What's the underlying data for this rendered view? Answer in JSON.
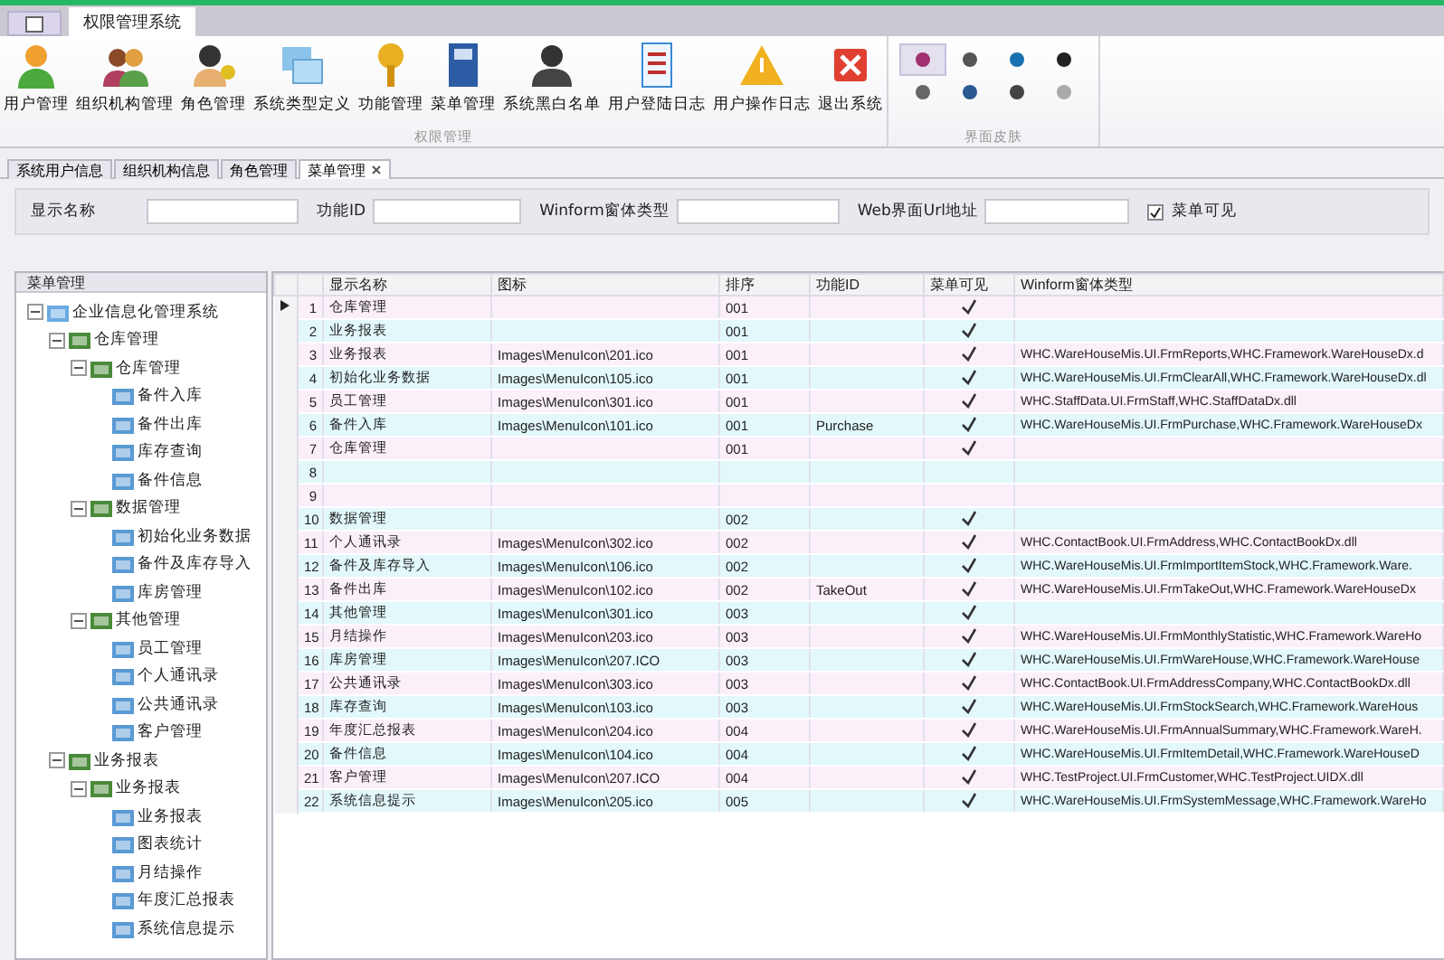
{
  "app_tab": "权限管理系统",
  "ribbon": {
    "groups": [
      {
        "label": "权限管理",
        "buttons": [
          {
            "label": "用户管理"
          },
          {
            "label": "组织机构管理"
          },
          {
            "label": "角色管理"
          },
          {
            "label": "系统类型定义"
          },
          {
            "label": "功能管理"
          },
          {
            "label": "菜单管理"
          },
          {
            "label": "系统黑白名单"
          },
          {
            "label": "用户登陆日志"
          },
          {
            "label": "用户操作日志"
          },
          {
            "label": "退出系统"
          }
        ]
      }
    ],
    "skins": {
      "label": "界面皮肤",
      "items": [
        {
          "selected": true
        },
        {
          "selected": false
        },
        {
          "selected": false
        },
        {
          "selected": false
        },
        {
          "selected": false
        },
        {
          "selected": false
        },
        {
          "selected": false
        },
        {
          "selected": false
        }
      ]
    }
  },
  "tabs": [
    {
      "label": "系统用户信息",
      "selected": false
    },
    {
      "label": "组织机构信息",
      "selected": false
    },
    {
      "label": "角色管理",
      "selected": false
    },
    {
      "label": "菜单管理",
      "selected": true
    }
  ],
  "filter": {
    "fields": [
      {
        "label": "显示名称"
      },
      {
        "label": "功能ID"
      },
      {
        "label": "Winform窗体类型"
      },
      {
        "label": "Web界面Url地址"
      }
    ],
    "visible": {
      "label": "菜单可见",
      "checked": true
    }
  },
  "tree": {
    "title": "菜单管理",
    "items": [
      {
        "label": "企业信息化管理系统",
        "expanded": true,
        "children": [
          {
            "label": "仓库管理",
            "expanded": true,
            "children": [
              {
                "label": "仓库管理",
                "expanded": true,
                "children": [
                  {
                    "label": "备件入库"
                  },
                  {
                    "label": "备件出库"
                  },
                  {
                    "label": "库存查询"
                  },
                  {
                    "label": "备件信息"
                  }
                ]
              },
              {
                "label": "数据管理",
                "expanded": true,
                "children": [
                  {
                    "label": "初始化业务数据"
                  },
                  {
                    "label": "备件及库存导入"
                  },
                  {
                    "label": "库房管理"
                  }
                ]
              },
              {
                "label": "其他管理",
                "expanded": true,
                "children": [
                  {
                    "label": "员工管理"
                  },
                  {
                    "label": "个人通讯录"
                  },
                  {
                    "label": "公共通讯录"
                  },
                  {
                    "label": "客户管理"
                  }
                ]
              }
            ]
          },
          {
            "label": "业务报表",
            "expanded": true,
            "children": [
              {
                "label": "业务报表",
                "expanded": true,
                "children": [
                  {
                    "label": "业务报表"
                  },
                  {
                    "label": "图表统计"
                  },
                  {
                    "label": "月结操作"
                  },
                  {
                    "label": "年度汇总报表"
                  },
                  {
                    "label": "系统信息提示"
                  }
                ]
              }
            ]
          }
        ]
      }
    ]
  },
  "table": {
    "columns": [
      "显示名称",
      "图标",
      "排序",
      "功能ID",
      "菜单可见",
      "Winform窗体类型"
    ],
    "rows": [
      {
        "no": "1",
        "selected": true,
        "name": "仓库管理",
        "icon": "",
        "sort": "001",
        "func": "",
        "visible": true,
        "winform": ""
      },
      {
        "no": "2",
        "selected": false,
        "name": "业务报表",
        "icon": "",
        "sort": "001",
        "func": "",
        "visible": true,
        "winform": ""
      },
      {
        "no": "3",
        "selected": false,
        "name": "业务报表",
        "icon": "Images\\MenuIcon\\201.ico",
        "sort": "001",
        "func": "",
        "visible": true,
        "winform": "WHC.WareHouseMis.UI.FrmReports,WHC.Framework.WareHouseDx.d"
      },
      {
        "no": "4",
        "selected": false,
        "name": "初始化业务数据",
        "icon": "Images\\MenuIcon\\105.ico",
        "sort": "001",
        "func": "",
        "visible": true,
        "winform": "WHC.WareHouseMis.UI.FrmClearAll,WHC.Framework.WareHouseDx.dl"
      },
      {
        "no": "5",
        "selected": false,
        "name": "员工管理",
        "icon": "Images\\MenuIcon\\301.ico",
        "sort": "001",
        "func": "",
        "visible": true,
        "winform": "WHC.StaffData.UI.FrmStaff,WHC.StaffDataDx.dll"
      },
      {
        "no": "6",
        "selected": false,
        "name": "备件入库",
        "icon": "Images\\MenuIcon\\101.ico",
        "sort": "001",
        "func": "Purchase",
        "visible": true,
        "winform": "WHC.WareHouseMis.UI.FrmPurchase,WHC.Framework.WareHouseDx"
      },
      {
        "no": "7",
        "selected": false,
        "name": "仓库管理",
        "icon": "",
        "sort": "001",
        "func": "",
        "visible": true,
        "winform": ""
      },
      {
        "no": "8",
        "selected": false,
        "name": "",
        "icon": "",
        "sort": "",
        "func": "",
        "winform": ""
      },
      {
        "no": "9",
        "selected": false,
        "name": "",
        "icon": "",
        "sort": "",
        "func": "",
        "winform": ""
      },
      {
        "no": "10",
        "selected": false,
        "name": "数据管理",
        "icon": "",
        "sort": "002",
        "func": "",
        "visible": true,
        "winform": ""
      },
      {
        "no": "11",
        "selected": false,
        "name": "个人通讯录",
        "icon": "Images\\MenuIcon\\302.ico",
        "sort": "002",
        "func": "",
        "visible": true,
        "winform": "WHC.ContactBook.UI.FrmAddress,WHC.ContactBookDx.dll"
      },
      {
        "no": "12",
        "selected": false,
        "name": "备件及库存导入",
        "icon": "Images\\MenuIcon\\106.ico",
        "sort": "002",
        "func": "",
        "visible": true,
        "winform": "WHC.WareHouseMis.UI.FrmImportItemStock,WHC.Framework.Ware."
      },
      {
        "no": "13",
        "selected": false,
        "name": "备件出库",
        "icon": "Images\\MenuIcon\\102.ico",
        "sort": "002",
        "func": "TakeOut",
        "visible": true,
        "winform": "WHC.WareHouseMis.UI.FrmTakeOut,WHC.Framework.WareHouseDx"
      },
      {
        "no": "14",
        "selected": false,
        "name": "其他管理",
        "icon": "Images\\MenuIcon\\301.ico",
        "sort": "003",
        "func": "",
        "visible": true,
        "winform": ""
      },
      {
        "no": "15",
        "selected": false,
        "name": "月结操作",
        "icon": "Images\\MenuIcon\\203.ico",
        "sort": "003",
        "func": "",
        "visible": true,
        "winform": "WHC.WareHouseMis.UI.FrmMonthlyStatistic,WHC.Framework.WareHo"
      },
      {
        "no": "16",
        "selected": false,
        "name": "库房管理",
        "icon": "Images\\MenuIcon\\207.ICO",
        "sort": "003",
        "func": "",
        "visible": true,
        "winform": "WHC.WareHouseMis.UI.FrmWareHouse,WHC.Framework.WareHouse"
      },
      {
        "no": "17",
        "selected": false,
        "name": "公共通讯录",
        "icon": "Images\\MenuIcon\\303.ico",
        "sort": "003",
        "func": "",
        "visible": true,
        "winform": "WHC.ContactBook.UI.FrmAddressCompany,WHC.ContactBookDx.dll"
      },
      {
        "no": "18",
        "selected": false,
        "name": "库存查询",
        "icon": "Images\\MenuIcon\\103.ico",
        "sort": "003",
        "func": "",
        "visible": true,
        "winform": "WHC.WareHouseMis.UI.FrmStockSearch,WHC.Framework.WareHous"
      },
      {
        "no": "19",
        "selected": false,
        "name": "年度汇总报表",
        "icon": "Images\\MenuIcon\\204.ico",
        "sort": "004",
        "func": "",
        "visible": true,
        "winform": "WHC.WareHouseMis.UI.FrmAnnualSummary,WHC.Framework.WareH."
      },
      {
        "no": "20",
        "selected": false,
        "name": "备件信息",
        "icon": "Images\\MenuIcon\\104.ico",
        "sort": "004",
        "func": "",
        "visible": true,
        "winform": "WHC.WareHouseMis.UI.FrmItemDetail,WHC.Framework.WareHouseD"
      },
      {
        "no": "21",
        "selected": false,
        "name": "客户管理",
        "icon": "Images\\MenuIcon\\207.ICO",
        "sort": "004",
        "func": "",
        "visible": true,
        "winform": "WHC.TestProject.UI.FrmCustomer,WHC.TestProject.UIDX.dll"
      },
      {
        "no": "22",
        "selected": false,
        "name": "系统信息提示",
        "icon": "Images\\MenuIcon\\205.ico",
        "sort": "005",
        "func": "",
        "visible": true,
        "winform": "WHC.WareHouseMis.UI.FrmSystemMessage,WHC.Framework.WareHo"
      }
    ]
  }
}
